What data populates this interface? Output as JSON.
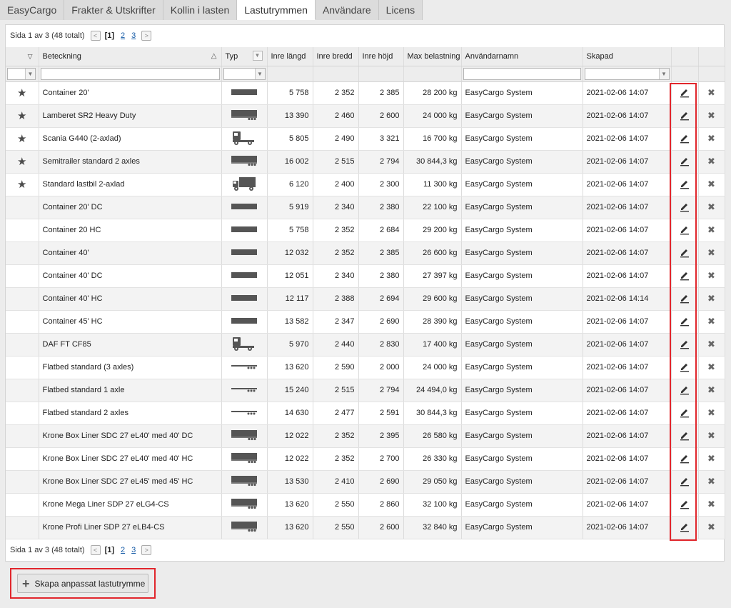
{
  "tabs": [
    {
      "label": "EasyCargo",
      "active": false
    },
    {
      "label": "Frakter & Utskrifter",
      "active": false
    },
    {
      "label": "Kollin i lasten",
      "active": false
    },
    {
      "label": "Lastutrymmen",
      "active": true
    },
    {
      "label": "Användare",
      "active": false
    },
    {
      "label": "Licens",
      "active": false
    }
  ],
  "pager": {
    "text": "Sida 1 av 3 (48 totalt)",
    "prev": "<",
    "next": ">",
    "current": "[1]",
    "pages": [
      "2",
      "3"
    ]
  },
  "columns": {
    "designation": "Beteckning",
    "type": "Typ",
    "inner_length": "Inre längd",
    "inner_width": "Inre bredd",
    "inner_height": "Inre höjd",
    "max_load": "Max belastning",
    "username": "Användarnamn",
    "created": "Skapad"
  },
  "rows": [
    {
      "favorite": true,
      "name": "Container 20'",
      "type_icon": "container-icon",
      "length": "5 758",
      "width": "2 352",
      "height": "2 385",
      "max_load": "28 200 kg",
      "user": "EasyCargo System",
      "created": "2021-02-06 14:07"
    },
    {
      "favorite": true,
      "name": "Lamberet SR2 Heavy Duty",
      "type_icon": "trailer-icon",
      "length": "13 390",
      "width": "2 460",
      "height": "2 600",
      "max_load": "24 000 kg",
      "user": "EasyCargo System",
      "created": "2021-02-06 14:07"
    },
    {
      "favorite": true,
      "name": "Scania G440 (2-axlad)",
      "type_icon": "tractor-icon",
      "length": "5 805",
      "width": "2 490",
      "height": "3 321",
      "max_load": "16 700 kg",
      "user": "EasyCargo System",
      "created": "2021-02-06 14:07"
    },
    {
      "favorite": true,
      "name": "Semitrailer standard 2 axles",
      "type_icon": "trailer-icon",
      "length": "16 002",
      "width": "2 515",
      "height": "2 794",
      "max_load": "30 844,3 kg",
      "user": "EasyCargo System",
      "created": "2021-02-06 14:07"
    },
    {
      "favorite": true,
      "name": "Standard lastbil 2-axlad",
      "type_icon": "truck-icon",
      "length": "6 120",
      "width": "2 400",
      "height": "2 300",
      "max_load": "11 300 kg",
      "user": "EasyCargo System",
      "created": "2021-02-06 14:07"
    },
    {
      "favorite": false,
      "name": "Container 20' DC",
      "type_icon": "container-icon",
      "length": "5 919",
      "width": "2 340",
      "height": "2 380",
      "max_load": "22 100 kg",
      "user": "EasyCargo System",
      "created": "2021-02-06 14:07"
    },
    {
      "favorite": false,
      "name": "Container 20 HC",
      "type_icon": "container-icon",
      "length": "5 758",
      "width": "2 352",
      "height": "2 684",
      "max_load": "29 200 kg",
      "user": "EasyCargo System",
      "created": "2021-02-06 14:07"
    },
    {
      "favorite": false,
      "name": "Container 40'",
      "type_icon": "container-icon",
      "length": "12 032",
      "width": "2 352",
      "height": "2 385",
      "max_load": "26 600 kg",
      "user": "EasyCargo System",
      "created": "2021-02-06 14:07"
    },
    {
      "favorite": false,
      "name": "Container 40' DC",
      "type_icon": "container-icon",
      "length": "12 051",
      "width": "2 340",
      "height": "2 380",
      "max_load": "27 397 kg",
      "user": "EasyCargo System",
      "created": "2021-02-06 14:07"
    },
    {
      "favorite": false,
      "name": "Container 40' HC",
      "type_icon": "container-icon",
      "length": "12 117",
      "width": "2 388",
      "height": "2 694",
      "max_load": "29 600 kg",
      "user": "EasyCargo System",
      "created": "2021-02-06 14:14"
    },
    {
      "favorite": false,
      "name": "Container 45' HC",
      "type_icon": "container-icon",
      "length": "13 582",
      "width": "2 347",
      "height": "2 690",
      "max_load": "28 390 kg",
      "user": "EasyCargo System",
      "created": "2021-02-06 14:07"
    },
    {
      "favorite": false,
      "name": "DAF FT CF85",
      "type_icon": "tractor-icon",
      "length": "5 970",
      "width": "2 440",
      "height": "2 830",
      "max_load": "17 400 kg",
      "user": "EasyCargo System",
      "created": "2021-02-06 14:07"
    },
    {
      "favorite": false,
      "name": "Flatbed standard (3 axles)",
      "type_icon": "flatbed-icon",
      "length": "13 620",
      "width": "2 590",
      "height": "2 000",
      "max_load": "24 000 kg",
      "user": "EasyCargo System",
      "created": "2021-02-06 14:07"
    },
    {
      "favorite": false,
      "name": "Flatbed standard 1 axle",
      "type_icon": "flatbed-icon",
      "length": "15 240",
      "width": "2 515",
      "height": "2 794",
      "max_load": "24 494,0 kg",
      "user": "EasyCargo System",
      "created": "2021-02-06 14:07"
    },
    {
      "favorite": false,
      "name": "Flatbed standard 2 axles",
      "type_icon": "flatbed-icon",
      "length": "14 630",
      "width": "2 477",
      "height": "2 591",
      "max_load": "30 844,3 kg",
      "user": "EasyCargo System",
      "created": "2021-02-06 14:07"
    },
    {
      "favorite": false,
      "name": "Krone Box Liner SDC 27 eL40' med 40' DC",
      "type_icon": "trailer-icon",
      "length": "12 022",
      "width": "2 352",
      "height": "2 395",
      "max_load": "26 580 kg",
      "user": "EasyCargo System",
      "created": "2021-02-06 14:07"
    },
    {
      "favorite": false,
      "name": "Krone Box Liner SDC 27 eL40' med 40' HC",
      "type_icon": "trailer-icon",
      "length": "12 022",
      "width": "2 352",
      "height": "2 700",
      "max_load": "26 330 kg",
      "user": "EasyCargo System",
      "created": "2021-02-06 14:07"
    },
    {
      "favorite": false,
      "name": "Krone Box Liner SDC 27 eL45' med 45' HC",
      "type_icon": "trailer-icon",
      "length": "13 530",
      "width": "2 410",
      "height": "2 690",
      "max_load": "29 050 kg",
      "user": "EasyCargo System",
      "created": "2021-02-06 14:07"
    },
    {
      "favorite": false,
      "name": "Krone Mega Liner SDP 27 eLG4-CS",
      "type_icon": "trailer-icon",
      "length": "13 620",
      "width": "2 550",
      "height": "2 860",
      "max_load": "32 100 kg",
      "user": "EasyCargo System",
      "created": "2021-02-06 14:07"
    },
    {
      "favorite": false,
      "name": "Krone Profi Liner SDP 27 eLB4-CS",
      "type_icon": "trailer-icon",
      "length": "13 620",
      "width": "2 550",
      "height": "2 600",
      "max_load": "32 840 kg",
      "user": "EasyCargo System",
      "created": "2021-02-06 14:07"
    }
  ],
  "actions": {
    "edit_icon": "pencil-icon",
    "delete_icon": "close-icon",
    "delete_glyph": "✖"
  },
  "create_button": {
    "label": "Skapa anpassat lastutrymme"
  },
  "colors": {
    "highlight": "#e1262c",
    "accent": "#1a5ea8"
  }
}
